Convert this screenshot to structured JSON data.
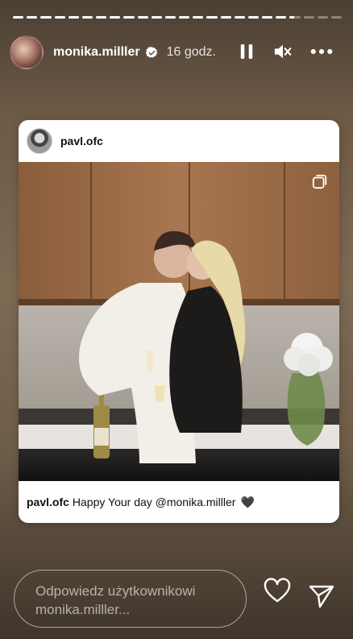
{
  "story": {
    "segments": [
      1,
      1,
      1,
      1,
      1,
      1,
      1,
      1,
      1,
      1,
      1,
      1,
      1,
      1,
      1,
      1,
      1,
      1,
      1,
      1,
      0.4,
      0,
      0,
      0
    ],
    "username": "monika.milller",
    "time": "16 godz."
  },
  "icons": {
    "verified": "verified-badge-icon",
    "pause": "pause-icon",
    "mute": "speaker-muted-icon",
    "more": "more-dots-icon",
    "layers": "multiple-photos-icon",
    "like": "heart-icon",
    "send": "send-icon"
  },
  "post": {
    "username": "pavl.ofc",
    "caption_user": "pavl.ofc",
    "caption_text": "Happy Your day @monika.milller",
    "caption_emoji": "🖤"
  },
  "reply": {
    "placeholder": "Odpowiedz użytkownikowi monika.milller..."
  },
  "colors": {
    "card": "#ffffff",
    "caption": "#111111"
  }
}
